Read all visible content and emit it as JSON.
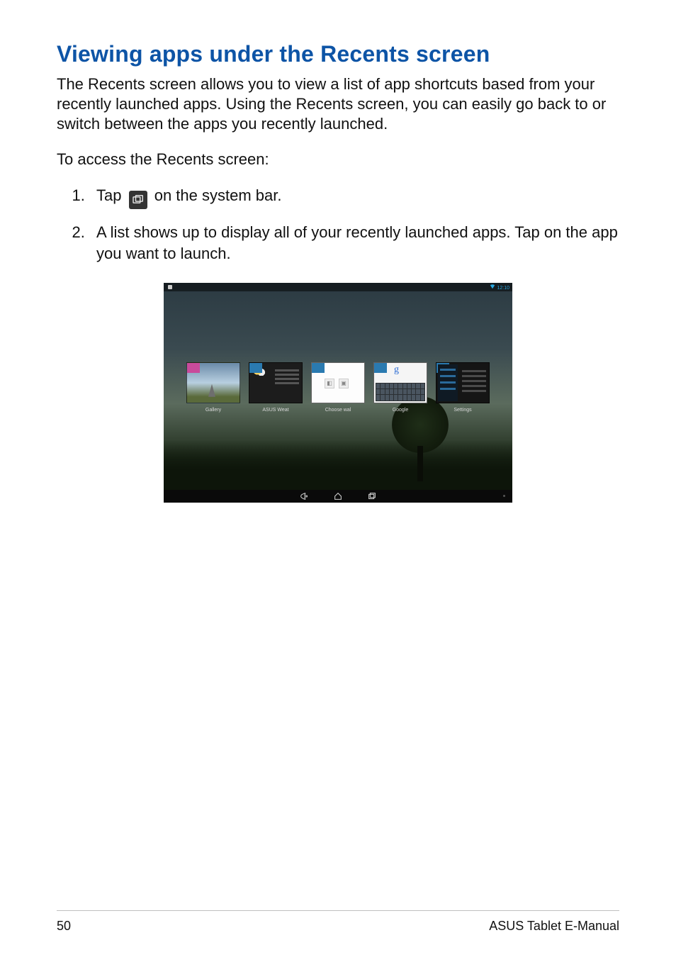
{
  "heading": "Viewing apps under the Recents screen",
  "intro": "The Recents screen allows you to view a list of app shortcuts based from your recently launched apps. Using the Recents screen, you can easily go back to or switch between the apps you recently launched.",
  "lead": "To access the Recents screen:",
  "steps": {
    "1a": "Tap ",
    "1b": " on the system bar.",
    "2": "A list shows up to display all of your recently launched apps. Tap on the app you want to launch."
  },
  "screenshot": {
    "status_time": "12:10",
    "recents": [
      {
        "label": "Gallery"
      },
      {
        "label": "ASUS Weat"
      },
      {
        "label": "Choose wal"
      },
      {
        "label": "Google"
      },
      {
        "label": "Settings"
      }
    ],
    "google_g": "g"
  },
  "footer": {
    "page": "50",
    "title": "ASUS Tablet E-Manual"
  }
}
